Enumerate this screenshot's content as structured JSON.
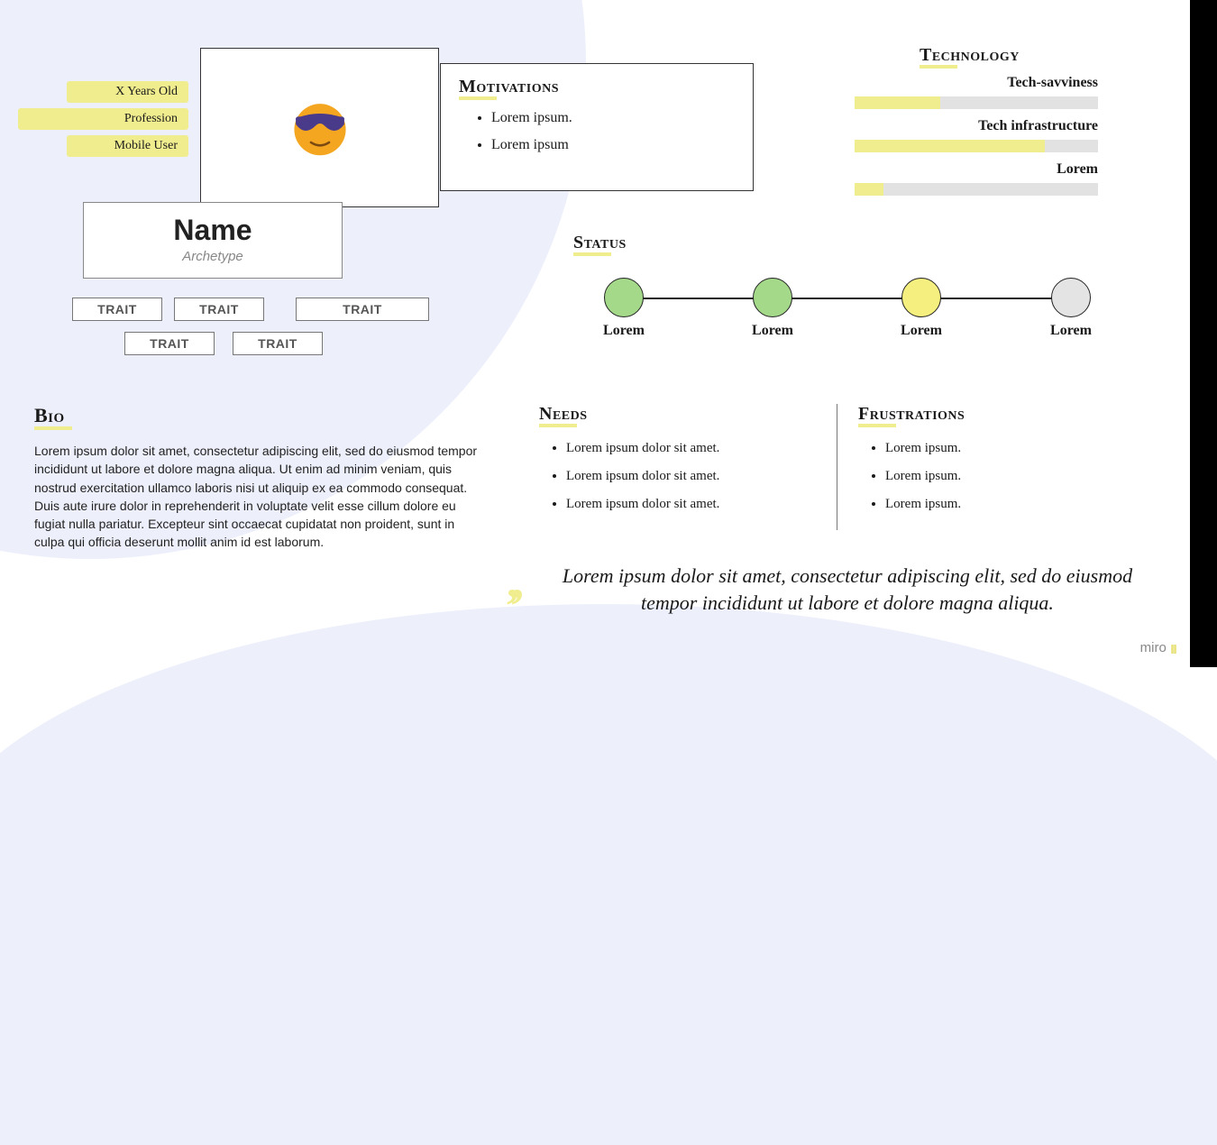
{
  "chips": {
    "age": "X  Years Old",
    "profession": "Profession",
    "mobile": "Mobile User"
  },
  "avatar": {
    "icon_name": "sunglasses-emoji"
  },
  "identity": {
    "name": "Name",
    "archetype": "Archetype"
  },
  "traits": [
    "TRAIT",
    "TRAIT",
    "TRAIT",
    "TRAIT",
    "TRAIT"
  ],
  "motivations": {
    "title": "Motivations",
    "items": [
      "Lorem ipsum.",
      "Lorem ipsum"
    ]
  },
  "technology": {
    "title": "Technology",
    "rows": [
      {
        "label": "Tech-savviness",
        "pct": 35
      },
      {
        "label": "Tech infrastructure",
        "pct": 78
      },
      {
        "label": "Lorem",
        "pct": 12
      }
    ]
  },
  "status": {
    "title": "Status",
    "steps": [
      {
        "label": "Lorem",
        "color": "g"
      },
      {
        "label": "Lorem",
        "color": "g"
      },
      {
        "label": "Lorem",
        "color": "y"
      },
      {
        "label": "Lorem",
        "color": "gray"
      }
    ]
  },
  "bio": {
    "title": "Bio",
    "text": "Lorem ipsum dolor sit amet, consectetur adipiscing elit, sed do eiusmod tempor incididunt ut labore et dolore magna aliqua. Ut enim ad minim veniam, quis nostrud exercitation ullamco laboris nisi ut aliquip ex ea commodo consequat. Duis aute irure dolor in reprehenderit in voluptate velit esse cillum dolore eu fugiat nulla pariatur. Excepteur sint occaecat cupidatat non proident, sunt in culpa qui officia deserunt mollit anim id est laborum."
  },
  "needs": {
    "title": "Needs",
    "items": [
      "Lorem ipsum dolor sit amet.",
      "Lorem ipsum dolor sit amet.",
      "Lorem ipsum dolor sit amet."
    ]
  },
  "frustrations": {
    "title": "Frustrations",
    "items": [
      "Lorem ipsum.",
      "Lorem ipsum.",
      "Lorem ipsum."
    ]
  },
  "quote": "Lorem ipsum dolor sit amet, consectetur adipiscing elit, sed do eiusmod tempor incididunt ut labore et dolore magna aliqua.",
  "watermark": "miro"
}
